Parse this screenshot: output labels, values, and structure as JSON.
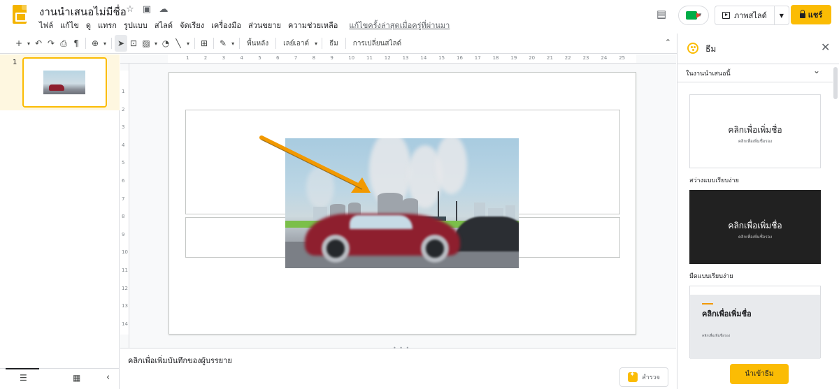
{
  "header": {
    "doc_title": "งานนำเสนอไม่มีชื่อ",
    "menu": [
      "ไฟล์",
      "แก้ไข",
      "ดู",
      "แทรก",
      "รูปแบบ",
      "สไลด์",
      "จัดเรียง",
      "เครื่องมือ",
      "ส่วนขยาย",
      "ความช่วยเหลือ"
    ],
    "last_edit": "แก้ไขครั้งล่าสุดเมื่อครู่ที่ผ่านมา",
    "slideshow_label": "ภาพสไลด์",
    "share_label": "แชร์"
  },
  "toolbar": {
    "background_label": "พื้นหลัง",
    "layout_label": "เลย์เอาต์",
    "theme_label": "ธีม",
    "transition_label": "การเปลี่ยนสไลด์"
  },
  "filmstrip": {
    "slide_number": "1"
  },
  "rulers": {
    "h_ticks": [
      "1",
      "2",
      "3",
      "4",
      "5",
      "6",
      "7",
      "8",
      "9",
      "10",
      "11",
      "12",
      "13",
      "14",
      "15",
      "16",
      "17",
      "18",
      "19",
      "20",
      "21",
      "22",
      "23",
      "24",
      "25"
    ],
    "v_ticks": [
      "1",
      "2",
      "3",
      "4",
      "5",
      "6",
      "7",
      "8",
      "9",
      "10",
      "11",
      "12",
      "13",
      "14"
    ]
  },
  "notes": {
    "placeholder": "คลิกเพื่อเพิ่มบันทึกของผู้บรรยาย",
    "explore_label": "สำรวจ"
  },
  "theme_panel": {
    "title": "ธีม",
    "section_label": "ในงานนำเสนอนี้",
    "themes": [
      {
        "title": "คลิกเพื่อเพิ่มชื่อ",
        "subtitle": "คลิกเพื่อเพิ่มชื่อรอง",
        "name": "สว่างแบบเรียบง่าย"
      },
      {
        "title": "คลิกเพื่อเพิ่มชื่อ",
        "subtitle": "คลิกเพื่อเพิ่มชื่อรอง",
        "name": "มืดแบบเรียบง่าย"
      },
      {
        "title": "คลิกเพื่อเพิ่มชื่อ",
        "subtitle": "คลิกเพื่อเพิ่มชื่อรอง"
      }
    ],
    "import_label": "นำเข้าธีม"
  },
  "colors": {
    "accent": "#fbbc04",
    "filmstrip_active": "#fef7e0",
    "arrow": "#f29900"
  }
}
